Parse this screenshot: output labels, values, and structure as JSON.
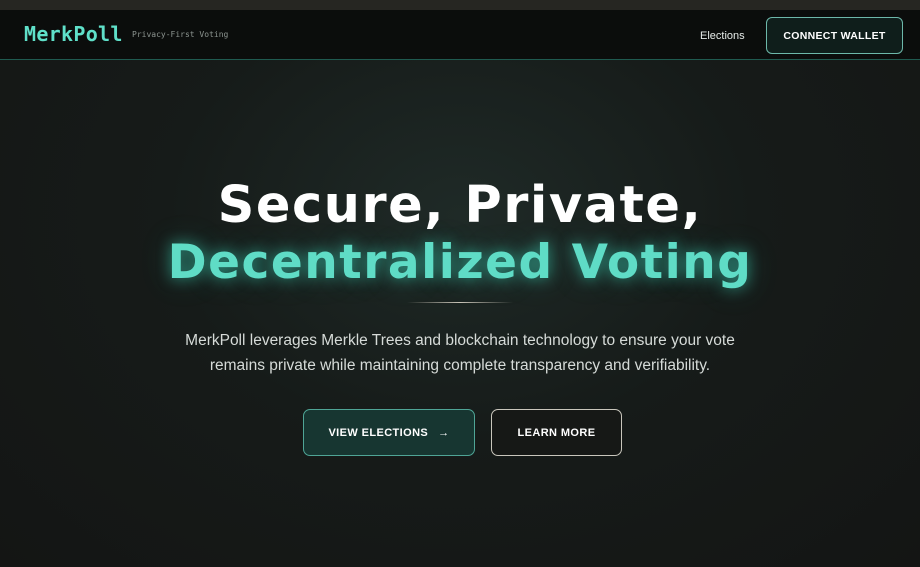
{
  "navbar": {
    "brand": "MerkPoll",
    "tagline": "Privacy-First Voting",
    "links": [
      {
        "label": "Elections"
      }
    ],
    "connect_label": "CONNECT WALLET"
  },
  "hero": {
    "title_line1": "Secure, Private,",
    "title_line2": "Decentralized Voting",
    "description": "MerkPoll leverages Merkle Trees and blockchain technology to ensure your vote remains private while maintaining complete transparency and verifiability.",
    "primary_label": "VIEW ELECTIONS",
    "primary_icon": "arrow-right-icon",
    "secondary_label": "LEARN MORE"
  },
  "colors": {
    "accent": "#5fdcc6",
    "background": "#161b19",
    "nav_background": "#0b0d0c"
  }
}
